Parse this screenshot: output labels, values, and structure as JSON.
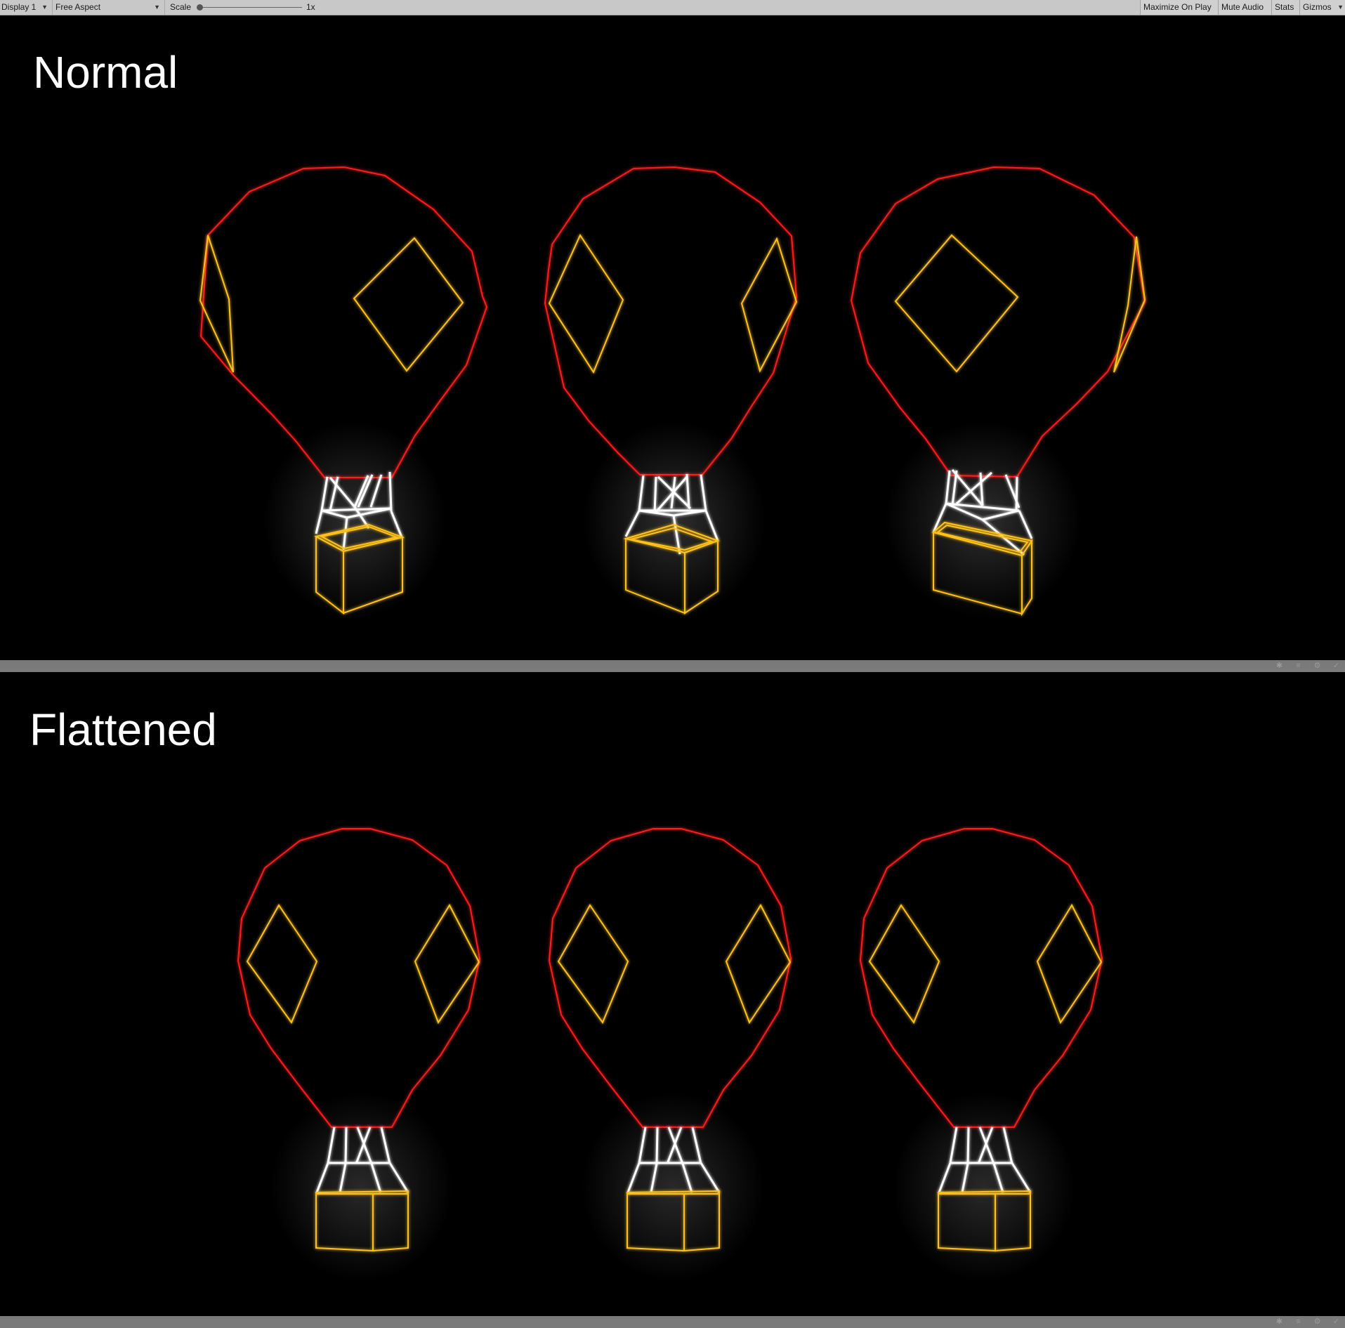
{
  "toolbar": {
    "display_label": "Display 1",
    "aspect_label": "Free Aspect",
    "scale_label": "Scale",
    "scale_value": "1x",
    "maximize_label": "Maximize On Play",
    "mute_label": "Mute Audio",
    "stats_label": "Stats",
    "gizmos_label": "Gizmos"
  },
  "panels": [
    {
      "label": "Normal"
    },
    {
      "label": "Flattened"
    }
  ],
  "colors": {
    "background": "#000000",
    "balloon_envelope": "#ff1a1a",
    "diamond": "#ffc21a",
    "rigging": "#ffffff",
    "basket": "#ffc21a",
    "toolbar": "#c8c8c8",
    "statusbar": "#7a7a7a"
  },
  "status_icons": [
    "bug-icon",
    "layers-icon",
    "settings-icon",
    "check-icon"
  ]
}
